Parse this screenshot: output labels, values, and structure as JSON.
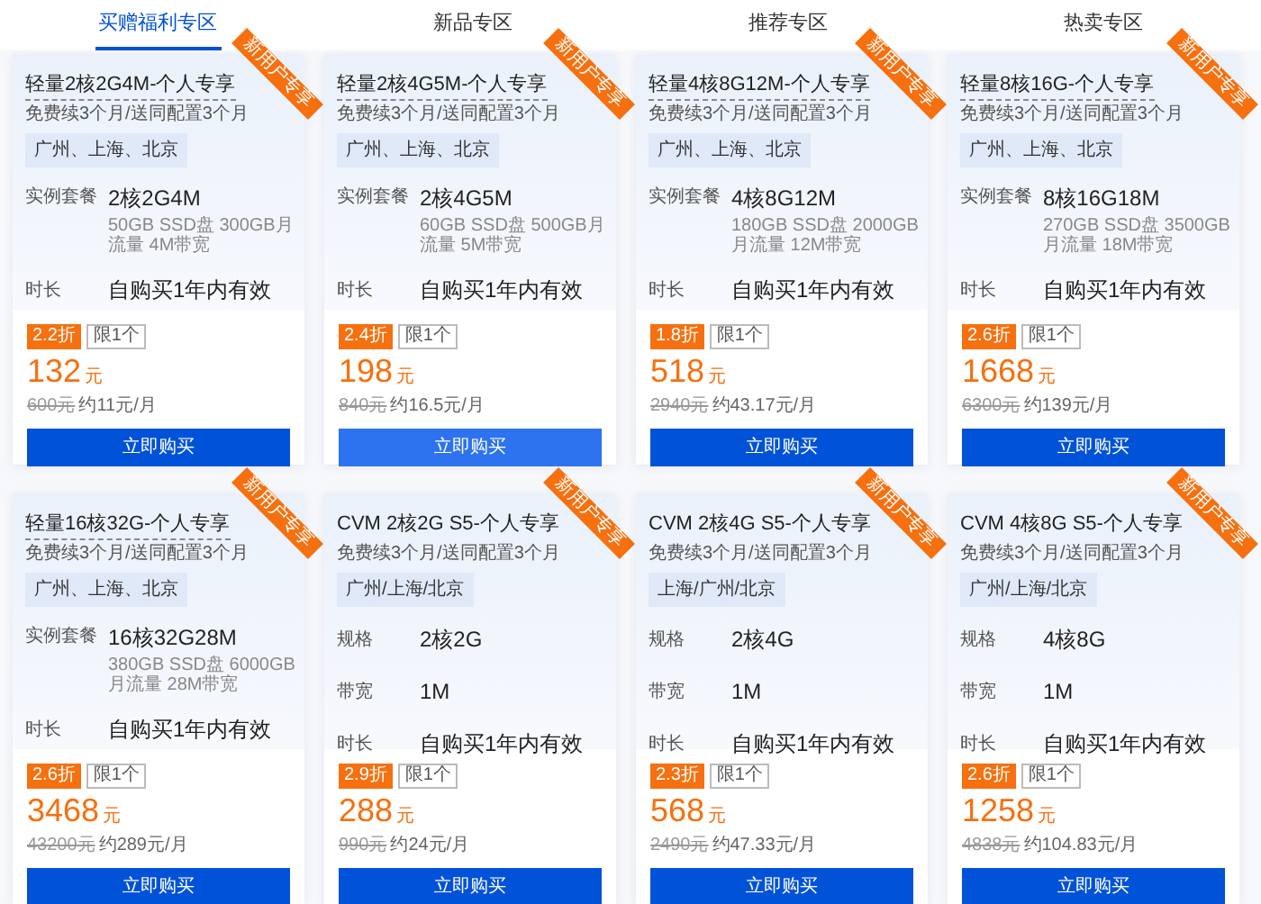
{
  "tabs": [
    {
      "label": "买赠福利专区",
      "selected": true
    },
    {
      "label": "新品专区",
      "selected": false
    },
    {
      "label": "推荐专区",
      "selected": false
    },
    {
      "label": "热卖专区",
      "selected": false
    }
  ],
  "cards": [
    {
      "title": "轻量2核2G4M-个人专享",
      "underlined": true,
      "ribbon": "新用户专享",
      "subtitle": "免费续3个月/送同配置3个月",
      "regions": "广州、上海、北京",
      "specs": [
        {
          "kind": "detail",
          "label": "实例套餐",
          "value": "2核2G4M",
          "detail": "50GB SSD盘 300GB月流量 4M带宽"
        },
        {
          "kind": "plain",
          "label": "时长",
          "value": "自购买1年内有效"
        }
      ],
      "discount": "2.2折",
      "limit": "限1个",
      "price": "132",
      "unit": "元",
      "original": "600元",
      "monthly": "约11元/月",
      "button": "立即购买",
      "hovered": false
    },
    {
      "title": "轻量2核4G5M-个人专享",
      "underlined": true,
      "ribbon": "新用户专享",
      "subtitle": "免费续3个月/送同配置3个月",
      "regions": "广州、上海、北京",
      "specs": [
        {
          "kind": "detail",
          "label": "实例套餐",
          "value": "2核4G5M",
          "detail": "60GB SSD盘 500GB月流量 5M带宽"
        },
        {
          "kind": "plain",
          "label": "时长",
          "value": "自购买1年内有效"
        }
      ],
      "discount": "2.4折",
      "limit": "限1个",
      "price": "198",
      "unit": "元",
      "original": "840元",
      "monthly": "约16.5元/月",
      "button": "立即购买",
      "hovered": true
    },
    {
      "title": "轻量4核8G12M-个人专享",
      "underlined": true,
      "ribbon": "新用户专享",
      "subtitle": "免费续3个月/送同配置3个月",
      "regions": "广州、上海、北京",
      "specs": [
        {
          "kind": "detail",
          "label": "实例套餐",
          "value": "4核8G12M",
          "detail": "180GB SSD盘 2000GB月流量 12M带宽"
        },
        {
          "kind": "plain",
          "label": "时长",
          "value": "自购买1年内有效"
        }
      ],
      "discount": "1.8折",
      "limit": "限1个",
      "price": "518",
      "unit": "元",
      "original": "2940元",
      "monthly": "约43.17元/月",
      "button": "立即购买",
      "hovered": false
    },
    {
      "title": "轻量8核16G-个人专享",
      "underlined": true,
      "ribbon": "新用户专享",
      "subtitle": "免费续3个月/送同配置3个月",
      "regions": "广州、上海、北京",
      "specs": [
        {
          "kind": "detail",
          "label": "实例套餐",
          "value": "8核16G18M",
          "detail": "270GB SSD盘 3500GB月流量 18M带宽"
        },
        {
          "kind": "plain",
          "label": "时长",
          "value": "自购买1年内有效"
        }
      ],
      "discount": "2.6折",
      "limit": "限1个",
      "price": "1668",
      "unit": "元",
      "original": "6300元",
      "monthly": "约139元/月",
      "button": "立即购买",
      "hovered": false
    },
    {
      "title": "轻量16核32G-个人专享",
      "underlined": true,
      "ribbon": "新用户专享",
      "subtitle": "免费续3个月/送同配置3个月",
      "regions": "广州、上海、北京",
      "specs": [
        {
          "kind": "detail",
          "label": "实例套餐",
          "value": "16核32G28M",
          "detail": "380GB SSD盘 6000GB月流量 28M带宽"
        },
        {
          "kind": "plain",
          "label": "时长",
          "value": "自购买1年内有效"
        }
      ],
      "discount": "2.6折",
      "limit": "限1个",
      "price": "3468",
      "unit": "元",
      "original": "43200元",
      "monthly": "约289元/月",
      "button": "立即购买",
      "hovered": false
    },
    {
      "title": "CVM 2核2G S5-个人专享",
      "underlined": false,
      "ribbon": "新用户专享",
      "subtitle": "免费续3个月/送同配置3个月",
      "regions": "广州/上海/北京",
      "specs": [
        {
          "kind": "plain",
          "label": "规格",
          "value": "2核2G"
        },
        {
          "kind": "plain",
          "label": "带宽",
          "value": "1M"
        },
        {
          "kind": "plain",
          "label": "时长",
          "value": "自购买1年内有效"
        }
      ],
      "discount": "2.9折",
      "limit": "限1个",
      "price": "288",
      "unit": "元",
      "original": "990元",
      "monthly": "约24元/月",
      "button": "立即购买",
      "hovered": false
    },
    {
      "title": "CVM 2核4G S5-个人专享",
      "underlined": false,
      "ribbon": "新用户专享",
      "subtitle": "免费续3个月/送同配置3个月",
      "regions": "上海/广州/北京",
      "specs": [
        {
          "kind": "plain",
          "label": "规格",
          "value": "2核4G"
        },
        {
          "kind": "plain",
          "label": "带宽",
          "value": "1M"
        },
        {
          "kind": "plain",
          "label": "时长",
          "value": "自购买1年内有效"
        }
      ],
      "discount": "2.3折",
      "limit": "限1个",
      "price": "568",
      "unit": "元",
      "original": "2490元",
      "monthly": "约47.33元/月",
      "button": "立即购买",
      "hovered": false
    },
    {
      "title": "CVM 4核8G S5-个人专享",
      "underlined": false,
      "ribbon": "新用户专享",
      "subtitle": "免费续3个月/送同配置3个月",
      "regions": "广州/上海/北京",
      "specs": [
        {
          "kind": "plain",
          "label": "规格",
          "value": "4核8G"
        },
        {
          "kind": "plain",
          "label": "带宽",
          "value": "1M"
        },
        {
          "kind": "plain",
          "label": "时长",
          "value": "自购买1年内有效"
        }
      ],
      "discount": "2.6折",
      "limit": "限1个",
      "price": "1258",
      "unit": "元",
      "original": "4838元",
      "monthly": "约104.83元/月",
      "button": "立即购买",
      "hovered": false
    }
  ]
}
